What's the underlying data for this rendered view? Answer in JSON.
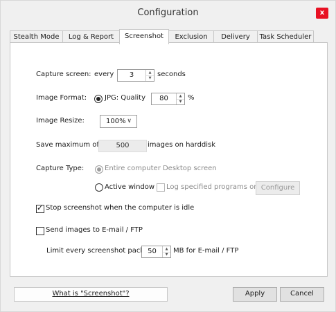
{
  "window": {
    "title": "Configuration",
    "close_label": "x"
  },
  "tabs": [
    {
      "label": "Stealth Mode"
    },
    {
      "label": "Log & Report"
    },
    {
      "label": "Screenshot"
    },
    {
      "label": "Exclusion"
    },
    {
      "label": "Delivery"
    },
    {
      "label": "Task Scheduler"
    }
  ],
  "capture": {
    "label": "Capture screen:",
    "every_label": "every",
    "value": "3",
    "unit_label": "seconds"
  },
  "format": {
    "label": "Image Format:",
    "option_label": "JPG: Quality",
    "quality": "80",
    "unit_label": "%"
  },
  "resize": {
    "label": "Image Resize:",
    "value": "100%"
  },
  "save": {
    "label": "Save maximum of:",
    "value": "500",
    "suffix": "images on harddisk"
  },
  "capture_type": {
    "label": "Capture Type:",
    "entire_label": "Entire computer Desktop screen",
    "active_label": "Active window",
    "log_programs_label": "Log specified programs only",
    "configure_label": "Configure"
  },
  "stop_idle": {
    "label": "Stop screenshot when the computer is idle",
    "checked": true
  },
  "send_images": {
    "label": "Send images to E-mail / FTP",
    "checked": false
  },
  "limit": {
    "label": "Limit every screenshot pack to",
    "value": "50",
    "suffix": "MB for E-mail / FTP"
  },
  "footer": {
    "help_label": "What is \"Screenshot\"?",
    "apply_label": "Apply",
    "cancel_label": "Cancel"
  }
}
